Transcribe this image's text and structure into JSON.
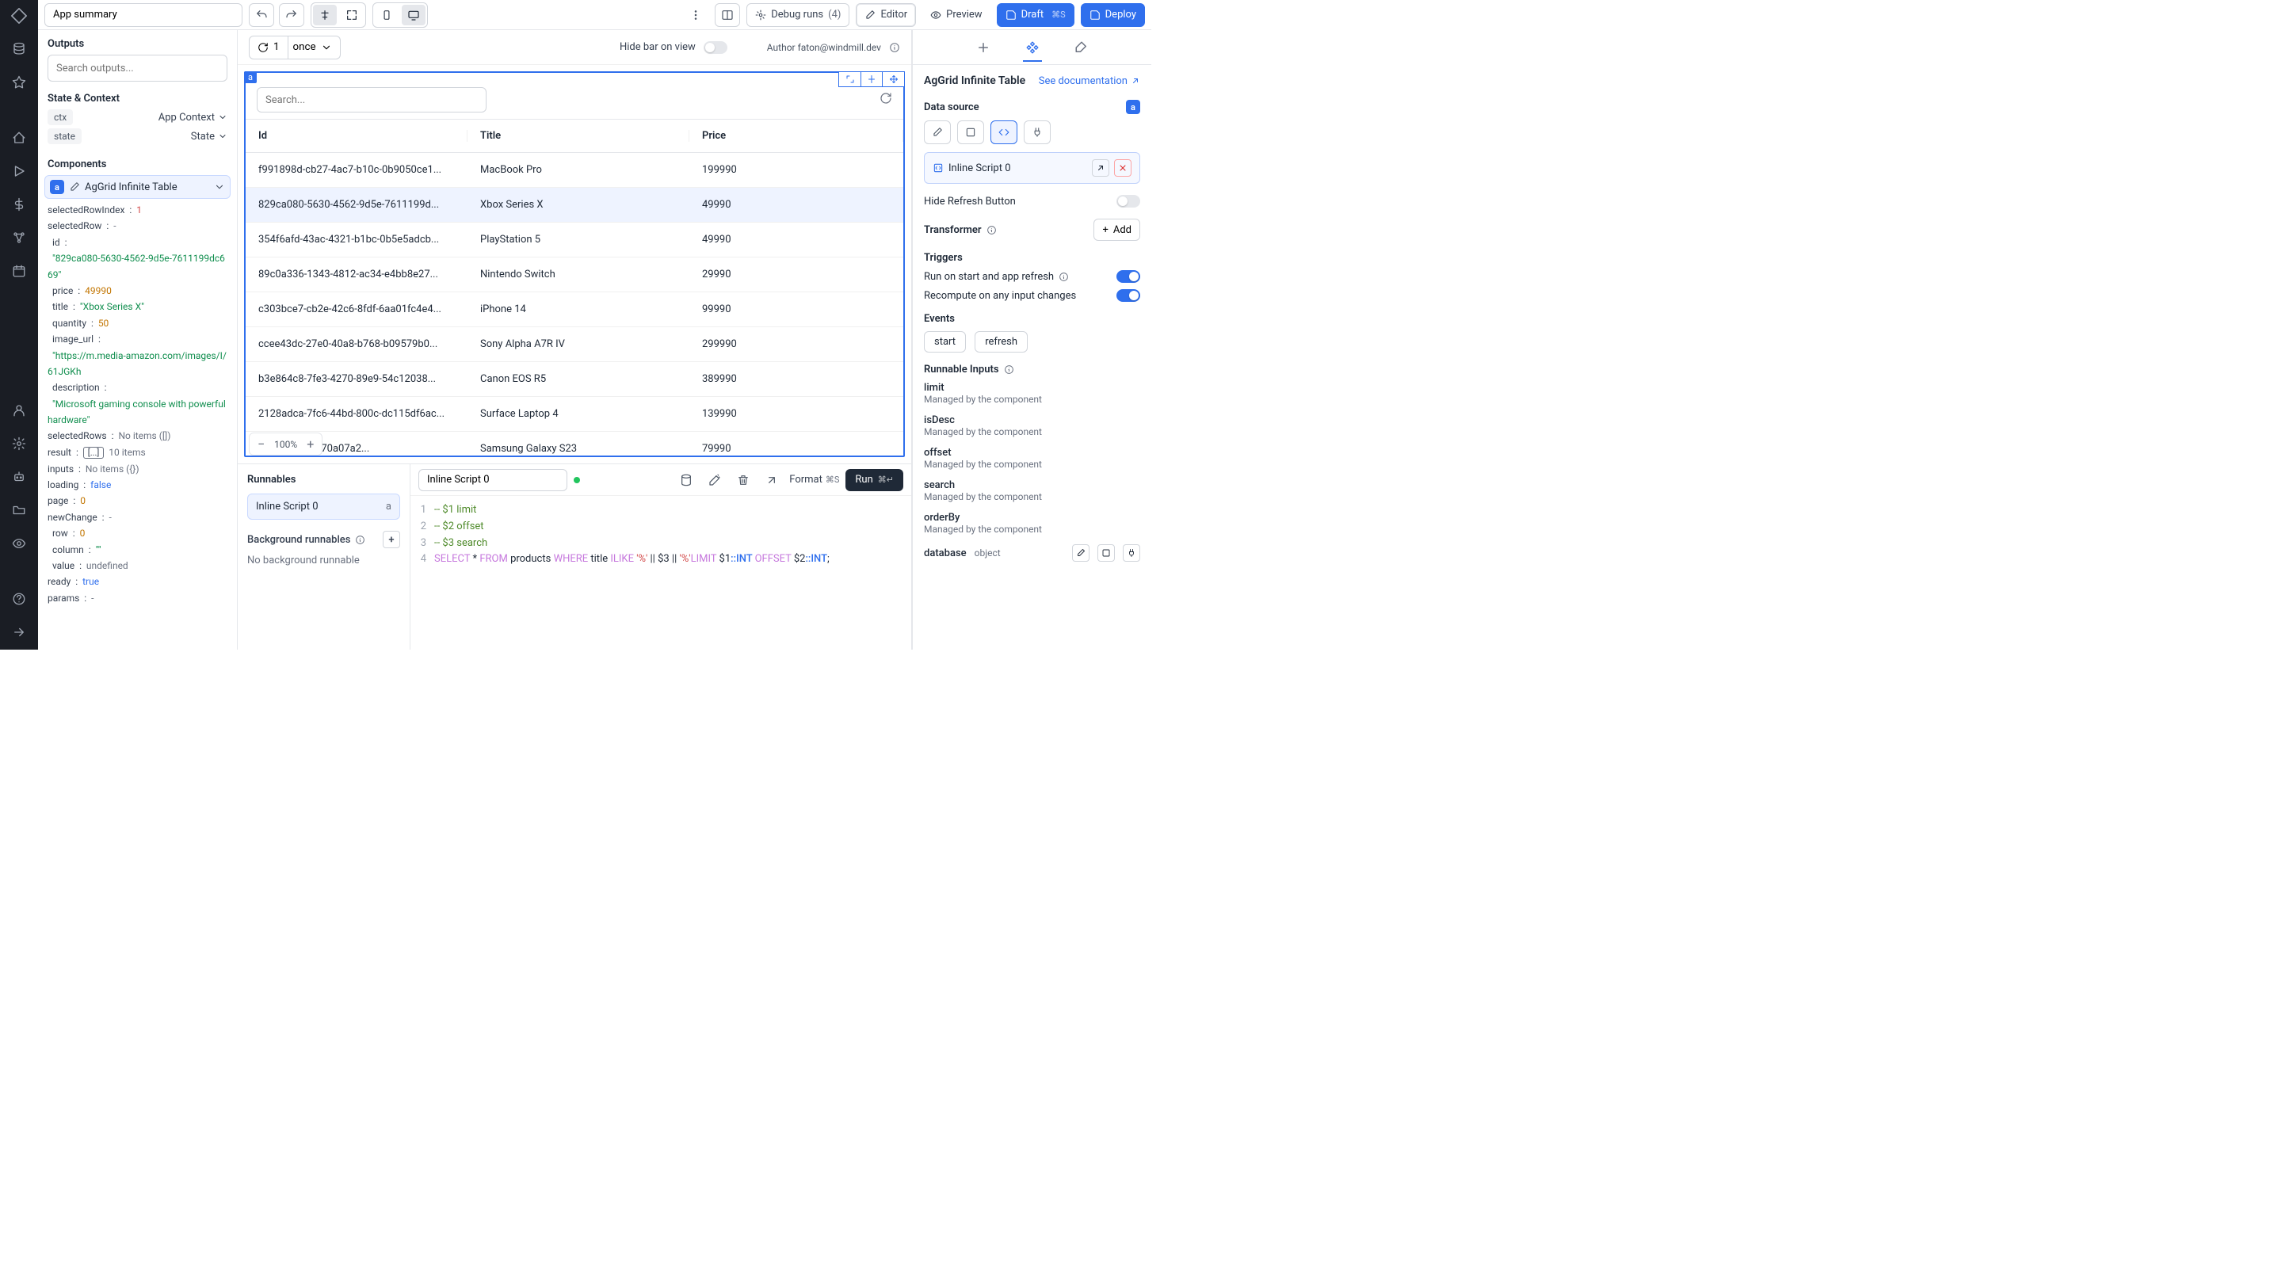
{
  "top": {
    "title": "App summary",
    "debug_label": "Debug runs",
    "debug_count": "(4)",
    "editor": "Editor",
    "preview": "Preview",
    "draft": "Draft",
    "draft_kbd": "⌘S",
    "deploy": "Deploy"
  },
  "left": {
    "outputs": "Outputs",
    "search_ph": "Search outputs...",
    "state_ctx": "State & Context",
    "ctx": "ctx",
    "app_ctx": "App Context",
    "state": "state",
    "state2": "State",
    "components": "Components",
    "comp_a": "a",
    "comp_name": "AgGrid Infinite Table",
    "props": {
      "selectedRowIndex_k": "selectedRowIndex",
      "selectedRowIndex_v": "1",
      "selectedRow_k": "selectedRow",
      "selectedRow_v": "-",
      "id_k": "id",
      "id_v": "\"829ca080-5630-4562-9d5e-7611199dc669\"",
      "price_k": "price",
      "price_v": "49990",
      "title_k": "title",
      "title_v": "\"Xbox Series X\"",
      "quantity_k": "quantity",
      "quantity_v": "50",
      "image_url_k": "image_url",
      "image_url_v": "\"https://m.media-amazon.com/images/I/61JGKh",
      "description_k": "description",
      "description_v": "\"Microsoft gaming console with powerful hardware\"",
      "selectedRows_k": "selectedRows",
      "selectedRows_v": "No items ([])",
      "result_k": "result",
      "result_box": "[...]",
      "result_v": "10 items",
      "inputs_k": "inputs",
      "inputs_v": "No items ({})",
      "loading_k": "loading",
      "loading_v": "false",
      "page_k": "page",
      "page_v": "0",
      "newChange_k": "newChange",
      "newChange_v": "-",
      "row_k": "row",
      "row_v": "0",
      "column_k": "column",
      "column_v": "\"\"",
      "value_k": "value",
      "value_v": "undefined",
      "ready_k": "ready",
      "ready_v": "true",
      "params_k": "params",
      "params_v": "-"
    }
  },
  "canvas": {
    "run_count": "1",
    "once": "once",
    "hide_bar": "Hide bar on view",
    "author_lbl": "Author",
    "author": "faton@windmill.dev",
    "search_ph": "Search...",
    "zoom": "100%",
    "cols": {
      "id": "Id",
      "title": "Title",
      "price": "Price"
    },
    "rows": [
      {
        "id": "f991898d-cb27-4ac7-b10c-0b9050ce1...",
        "title": "MacBook Pro",
        "price": "199990"
      },
      {
        "id": "829ca080-5630-4562-9d5e-7611199d...",
        "title": "Xbox Series X",
        "price": "49990"
      },
      {
        "id": "354f6afd-43ac-4321-b1bc-0b5e5adcb...",
        "title": "PlayStation 5",
        "price": "49990"
      },
      {
        "id": "89c0a336-1343-4812-ac34-e4bb8e27...",
        "title": "Nintendo Switch",
        "price": "29990"
      },
      {
        "id": "c303bce7-cb2e-42c6-8fdf-6aa01fc4e4...",
        "title": "iPhone 14",
        "price": "99990"
      },
      {
        "id": "ccee43dc-27e0-40a8-b768-b09579b0...",
        "title": "Sony Alpha A7R IV",
        "price": "299990"
      },
      {
        "id": "b3e864c8-7fe3-4270-89e9-54c12038...",
        "title": "Canon EOS R5",
        "price": "389990"
      },
      {
        "id": "2128adca-7fc6-44bd-800c-dc115df6ac...",
        "title": "Surface Laptop 4",
        "price": "139990"
      },
      {
        "id": "4c83-8022-5e70a07a2...",
        "title": "Samsung Galaxy S23",
        "price": "79990"
      }
    ]
  },
  "bot": {
    "runnables": "Runnables",
    "script": "Inline Script 0",
    "badge": "a",
    "bg": "Background runnables",
    "nobg": "No background runnable",
    "script_name": "Inline Script 0",
    "format": "Format",
    "format_kbd": "⌘S",
    "run": "Run",
    "run_kbd": "⌘↵",
    "code_lines": [
      {
        "n": "1",
        "c": "-- $1 limit",
        "cls": "com"
      },
      {
        "n": "2",
        "c": "-- $2 offset",
        "cls": "com"
      },
      {
        "n": "3",
        "c": "-- $3 search",
        "cls": "com"
      }
    ],
    "l4n": "4",
    "l4_select": "SELECT",
    "l4_star": " * ",
    "l4_from": "FROM",
    "l4_products": " products ",
    "l4_where": "WHERE",
    "l4_title": " title ",
    "l4_ilike": "ILIKE",
    "l4_q1": " '%'",
    "l4_p1": " || $3 || ",
    "l4_q2": "'%'",
    "l4_limit": "LIMIT",
    "l4_d1": " $1",
    "l4_cast1": "::INT ",
    "l4_offset": "OFFSET",
    "l4_d2": " $2",
    "l4_cast2": "::INT",
    "l4_semi": ";"
  },
  "right": {
    "title": "AgGrid Infinite Table",
    "doc": "See documentation",
    "ds": "Data source",
    "inline": "Inline Script 0",
    "hide_refresh": "Hide Refresh Button",
    "transformer": "Transformer",
    "add": "Add",
    "triggers": "Triggers",
    "t1": "Run on start and app refresh",
    "t2": "Recompute on any input changes",
    "events": "Events",
    "ev1": "start",
    "ev2": "refresh",
    "ri": "Runnable Inputs",
    "managed": "Managed by the component",
    "inputs": [
      "limit",
      "isDesc",
      "offset",
      "search",
      "orderBy"
    ],
    "db": "database",
    "db_type": "object"
  }
}
